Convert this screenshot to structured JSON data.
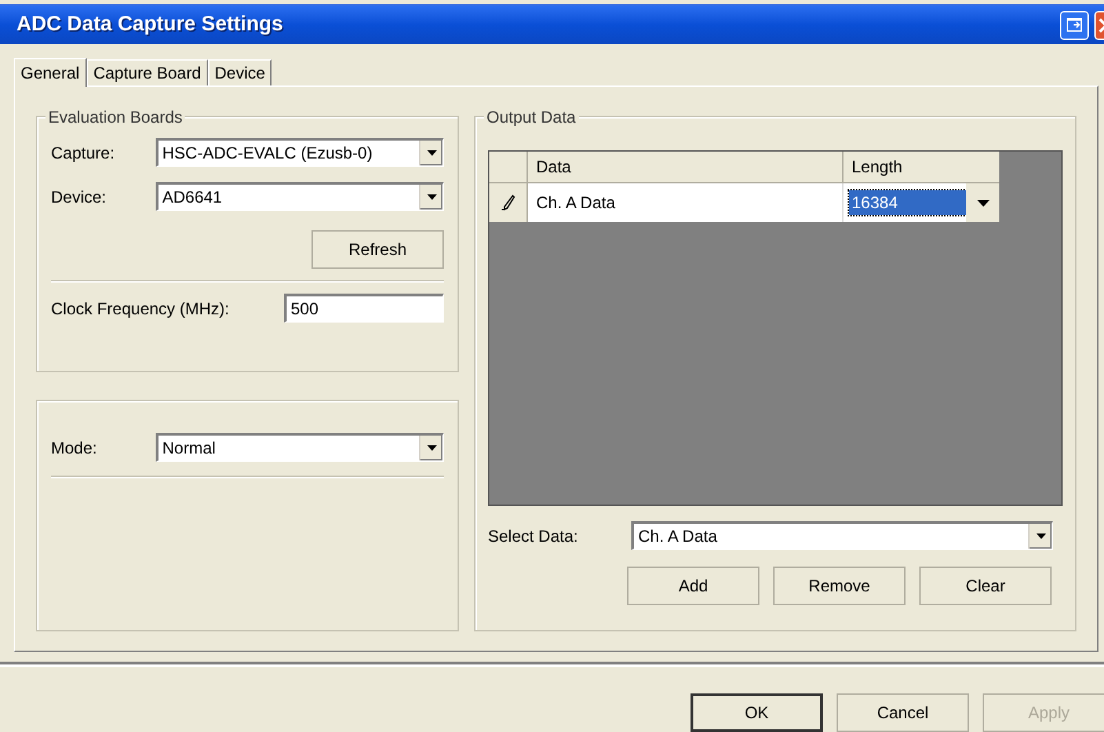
{
  "window": {
    "title": "ADC Data Capture Settings"
  },
  "tabs": [
    {
      "label": "General",
      "selected": true
    },
    {
      "label": "Capture Board",
      "selected": false
    },
    {
      "label": "Device",
      "selected": false
    }
  ],
  "evaluation_boards": {
    "title": "Evaluation Boards",
    "capture": {
      "label": "Capture:",
      "value": "HSC-ADC-EVALC (Ezusb-0)"
    },
    "device": {
      "label": "Device:",
      "value": "AD6641"
    },
    "refresh_button": "Refresh",
    "clock": {
      "label": "Clock Frequency (MHz):",
      "value": "500"
    }
  },
  "mode": {
    "label": "Mode:",
    "value": "Normal"
  },
  "output_data": {
    "title": "Output Data",
    "table": {
      "columns": [
        "Data",
        "Length"
      ],
      "rows": [
        {
          "data": "Ch. A Data",
          "length": "16384",
          "editing": true,
          "selected": true
        }
      ]
    },
    "select_data": {
      "label": "Select Data:",
      "value": "Ch. A Data"
    },
    "buttons": [
      "Add",
      "Remove",
      "Clear"
    ]
  },
  "buttons": [
    {
      "label": "OK",
      "default": true,
      "disabled": false
    },
    {
      "label": "Cancel",
      "default": false,
      "disabled": false
    },
    {
      "label": "Apply",
      "default": false,
      "disabled": true
    }
  ]
}
